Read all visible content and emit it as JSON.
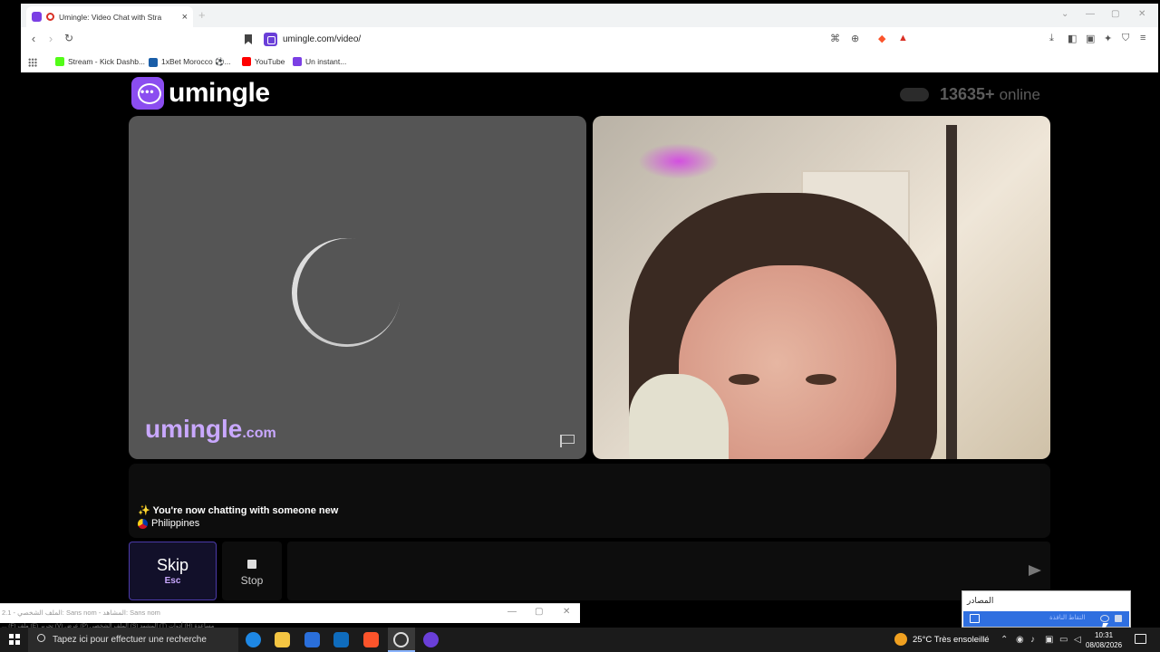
{
  "browser": {
    "tab_title": "Umingle: Video Chat with Stra",
    "tab_close": "×",
    "new_tab": "+",
    "url": "umingle.com/video/",
    "bookmarks": [
      {
        "label": "Stream - Kick Dashb...",
        "color": "#53fc18"
      },
      {
        "label": "1xBet Morocco ⚽...",
        "color": "#1a5ea8"
      },
      {
        "label": "YouTube",
        "color": "#ff0000"
      },
      {
        "label": "Un instant...",
        "color": "#7b3fe4"
      }
    ]
  },
  "page": {
    "logo_text": "umingle",
    "online_count": "13635+",
    "online_word": "online",
    "watermark_main": "umingle",
    "watermark_suffix": ".com",
    "chat_message": "✨ You're now chatting with someone new",
    "country": "Philippines",
    "skip_label": "Skip",
    "skip_key": "Esc",
    "stop_label": "Stop"
  },
  "desktop": {
    "small_window_title": "2.1 - الملف الشخصي: Sans nom - المشاهد: Sans nom",
    "strip_text": "... (F) ملف (E) تحرير (V) عرض (P) الملف الشخصي (S) المشهد (T) أدوات (H) مساعدة",
    "popup_title": "المصادر",
    "popup_row_text": "التقاط النافذة",
    "search_placeholder": "Tapez ici pour effectuer une recherche",
    "weather": "25°C  Très ensoleillé",
    "time": "10:31",
    "date": "08/08/2026"
  },
  "colors": {
    "brand": "#8b4df0",
    "skip_border": "#4b3aa8",
    "popup_highlight": "#2f6fe0"
  }
}
